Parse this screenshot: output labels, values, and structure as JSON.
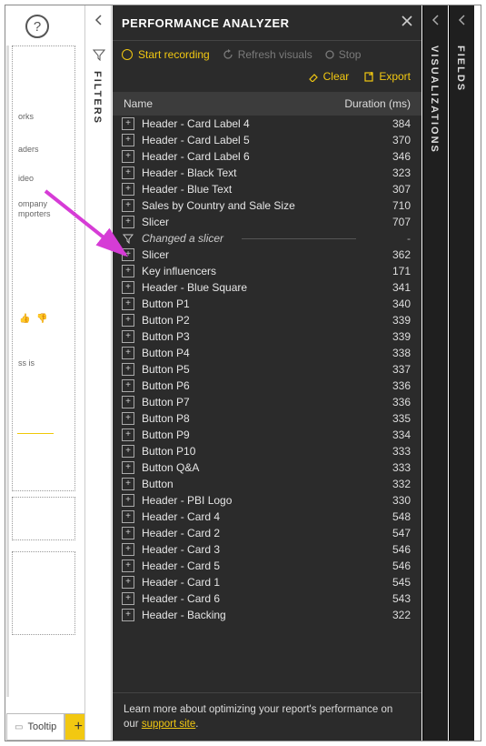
{
  "help_tooltip": "?",
  "canvas": {
    "frag1": "orks",
    "frag2": "aders",
    "frag3": "ideo",
    "frag4a": "ompany",
    "frag4b": "mporters",
    "frag5": "ss is",
    "thumbs": "👍 👎"
  },
  "bottom": {
    "tooltip_label": "Tooltip",
    "add_label": "+"
  },
  "filters": {
    "label": "FILTERS"
  },
  "panel": {
    "title": "PERFORMANCE ANALYZER",
    "start_recording": "Start recording",
    "refresh_visuals": "Refresh visuals",
    "stop": "Stop",
    "clear": "Clear",
    "export": "Export",
    "col_name": "Name",
    "col_duration": "Duration (ms)",
    "footer_text": "Learn more about optimizing your report's performance on our ",
    "footer_link": "support site"
  },
  "rows": [
    {
      "type": "item",
      "name": "Header - Card Label 4",
      "duration": "384"
    },
    {
      "type": "item",
      "name": "Header - Card Label 5",
      "duration": "370"
    },
    {
      "type": "item",
      "name": "Header - Card Label 6",
      "duration": "346"
    },
    {
      "type": "item",
      "name": "Header - Black Text",
      "duration": "323"
    },
    {
      "type": "item",
      "name": "Header - Blue Text",
      "duration": "307"
    },
    {
      "type": "item",
      "name": "Sales by Country and Sale Size",
      "duration": "710"
    },
    {
      "type": "item",
      "name": "Slicer",
      "duration": "707"
    },
    {
      "type": "event",
      "name": "Changed a slicer"
    },
    {
      "type": "item",
      "name": "Slicer",
      "duration": "362"
    },
    {
      "type": "item",
      "name": "Key influencers",
      "duration": "171"
    },
    {
      "type": "item",
      "name": "Header - Blue Square",
      "duration": "341"
    },
    {
      "type": "item",
      "name": "Button P1",
      "duration": "340"
    },
    {
      "type": "item",
      "name": "Button P2",
      "duration": "339"
    },
    {
      "type": "item",
      "name": "Button P3",
      "duration": "339"
    },
    {
      "type": "item",
      "name": "Button P4",
      "duration": "338"
    },
    {
      "type": "item",
      "name": "Button P5",
      "duration": "337"
    },
    {
      "type": "item",
      "name": "Button P6",
      "duration": "336"
    },
    {
      "type": "item",
      "name": "Button P7",
      "duration": "336"
    },
    {
      "type": "item",
      "name": "Button P8",
      "duration": "335"
    },
    {
      "type": "item",
      "name": "Button P9",
      "duration": "334"
    },
    {
      "type": "item",
      "name": "Button P10",
      "duration": "333"
    },
    {
      "type": "item",
      "name": "Button Q&A",
      "duration": "333"
    },
    {
      "type": "item",
      "name": "Button",
      "duration": "332"
    },
    {
      "type": "item",
      "name": "Header - PBI Logo",
      "duration": "330"
    },
    {
      "type": "item",
      "name": "Header - Card 4",
      "duration": "548"
    },
    {
      "type": "item",
      "name": "Header - Card 2",
      "duration": "547"
    },
    {
      "type": "item",
      "name": "Header - Card 3",
      "duration": "546"
    },
    {
      "type": "item",
      "name": "Header - Card 5",
      "duration": "546"
    },
    {
      "type": "item",
      "name": "Header - Card 1",
      "duration": "545"
    },
    {
      "type": "item",
      "name": "Header - Card 6",
      "duration": "543"
    },
    {
      "type": "item",
      "name": "Header - Backing",
      "duration": "322"
    }
  ],
  "rails": {
    "visualizations": "VISUALIZATIONS",
    "fields": "FIELDS"
  }
}
